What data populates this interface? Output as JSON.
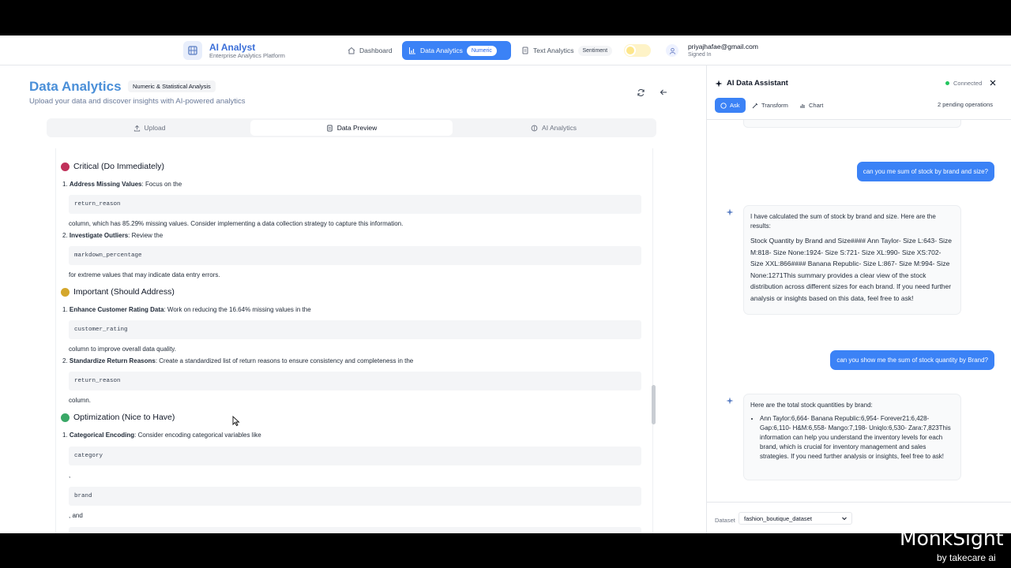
{
  "header": {
    "brand_title": "AI Analyst",
    "brand_subtitle": "Enterprise Analytics Platform",
    "nav": {
      "dashboard": "Dashboard",
      "data_analytics": "Data Analytics",
      "data_analytics_pill": "Numeric",
      "text_analytics": "Text Analytics",
      "text_analytics_pill": "Sentiment"
    },
    "user_email": "priyajhafae@gmail.com",
    "user_status": "Signed In"
  },
  "page": {
    "title": "Data Analytics",
    "badge": "Numeric & Statistical Analysis",
    "subtitle": "Upload your data and discover insights with AI-powered analytics",
    "tabs": [
      "Upload",
      "Data Preview",
      "AI Analytics"
    ]
  },
  "report": {
    "critical": {
      "heading": "Critical (Do Immediately)",
      "color": "#c0315a",
      "item1_title": "Address Missing Values",
      "item1_text": ": Focus on the",
      "item1_code": "return_reason",
      "item1_after": "column, which has 85.29% missing values. Consider implementing a data collection strategy to capture this information.",
      "item2_title": "Investigate Outliers",
      "item2_text": ": Review the",
      "item2_code": "markdown_percentage",
      "item2_after": "for extreme values that may indicate data entry errors."
    },
    "important": {
      "heading": "Important (Should Address)",
      "color": "#d4a72c",
      "item1_title": "Enhance Customer Rating Data",
      "item1_text": ": Work on reducing the 16.64% missing values in the",
      "item1_code": "customer_rating",
      "item1_after": "column to improve overall data quality.",
      "item2_title": "Standardize Return Reasons",
      "item2_text": ": Create a standardized list of return reasons to ensure consistency and completeness in the",
      "item2_code": "return_reason",
      "item2_after": "column."
    },
    "optimization": {
      "heading": "Optimization (Nice to Have)",
      "color": "#3aa867",
      "item1_title": "Categorical Encoding",
      "item1_text": ": Consider encoding categorical variables like",
      "code1": "category",
      "sep1": ",",
      "code2": "brand",
      "sep2": ", and"
    }
  },
  "assistant": {
    "title": "AI Data Assistant",
    "status": "Connected",
    "tabs": {
      "ask": "Ask",
      "transform": "Transform",
      "chart": "Chart"
    },
    "pending": "2 pending operations",
    "messages": {
      "user1": "can you me sum of stock by brand and size?",
      "bot1_lead": "I have calculated the sum of stock by brand and size. Here are the results:",
      "bot1_body": "Stock Quantity by Brand and Size#### Ann Taylor- Size L:643- Size M:818- Size None:1924- Size S:721- Size XL:990- Size XS:702- Size XXL:866#### Banana Republic- Size L:867- Size M:994- Size None:1271This summary provides a clear view of the stock distribution across different sizes for each brand. If you need further analysis or insights based on this data, feel free to ask!",
      "user2": "can you show me the sum of stock quantity by Brand?",
      "bot2_lead": "Here are the total stock quantities by brand:",
      "bot2_body": "Ann Taylor:6,664- Banana Republic:6,954- Forever21:6,428- Gap:6,110- H&M:6,558- Mango:7,198- Uniqlo:6,530- Zara:7,823This information can help you understand the inventory levels for each brand, which is crucial for inventory management and sales strategies. If you need further analysis or insights, feel free to ask!"
    },
    "dataset_label": "Dataset",
    "dataset_value": "fashion_boutique_dataset"
  },
  "watermark": {
    "title": "MonkSight",
    "subtitle": "by takecare ai"
  },
  "colors": {
    "accent": "#3b82f6",
    "title": "#4a8fd8",
    "connected": "#22c55e"
  }
}
